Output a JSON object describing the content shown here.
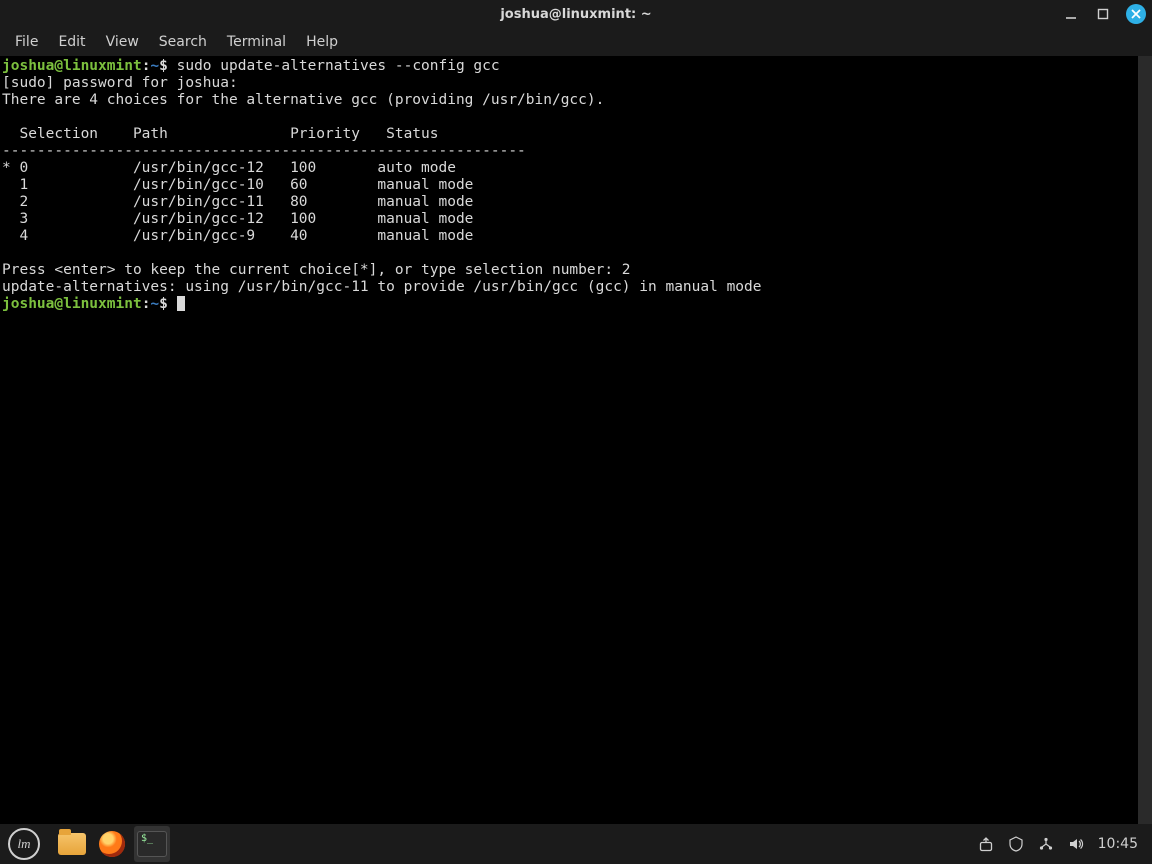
{
  "window": {
    "title": "joshua@linuxmint: ~"
  },
  "menu": {
    "file": "File",
    "edit": "Edit",
    "view": "View",
    "search": "Search",
    "terminal": "Terminal",
    "help": "Help"
  },
  "prompt": {
    "user_host": "joshua@linuxmint",
    "sep": ":",
    "path": "~",
    "symbol": "$"
  },
  "session": {
    "cmd1": " sudo update-alternatives --config gcc",
    "line_sudo": "[sudo] password for joshua: ",
    "line_choices": "There are 4 choices for the alternative gcc (providing /usr/bin/gcc).",
    "blank": "",
    "header": "  Selection    Path              Priority   Status",
    "divider": "------------------------------------------------------------",
    "row0": "* 0            /usr/bin/gcc-12   100       auto mode",
    "row1": "  1            /usr/bin/gcc-10   60        manual mode",
    "row2": "  2            /usr/bin/gcc-11   80        manual mode",
    "row3": "  3            /usr/bin/gcc-12   100       manual mode",
    "row4": "  4            /usr/bin/gcc-9    40        manual mode",
    "press": "Press <enter> to keep the current choice[*], or type selection number: 2",
    "result": "update-alternatives: using /usr/bin/gcc-11 to provide /usr/bin/gcc (gcc) in manual mode"
  },
  "taskbar": {
    "clock": "10:45",
    "start_glyph": "m"
  }
}
